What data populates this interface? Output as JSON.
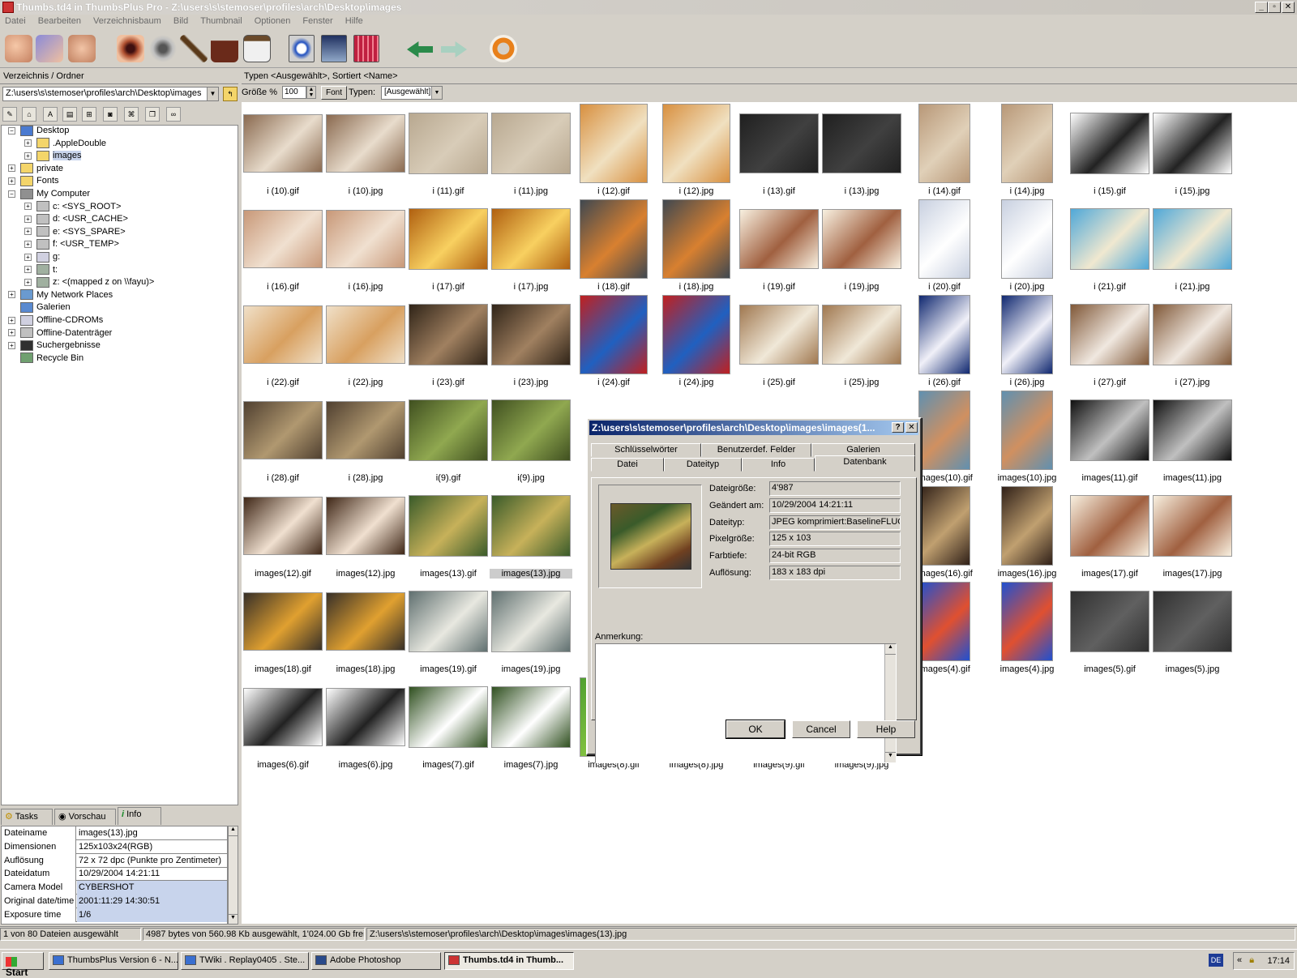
{
  "window": {
    "title": "Thumbs.td4 in ThumbsPlus Pro - Z:\\users\\s\\stemoser\\profiles\\arch\\Desktop\\images",
    "minimize": "_",
    "restore": "▫",
    "close": "✕"
  },
  "menu": [
    "Datei",
    "Bearbeiten",
    "Verzeichnisbaum",
    "Bild",
    "Thumbnail",
    "Optionen",
    "Fenster",
    "Hilfe"
  ],
  "toolbar": {
    "icons": [
      "hand-icon",
      "hand-doc-icon",
      "hand-fingers-icon",
      "eye-icon",
      "glasses-icon",
      "brush-icon",
      "briefcase-icon",
      "clipboard-icon",
      "monitor-icon",
      "slideshow-icon",
      "contact-sheet-icon",
      "back-arrow-icon",
      "forward-arrow-icon",
      "lifebuoy-icon"
    ]
  },
  "left_panel": {
    "header": "Verzeichnis / Ordner",
    "path": "Z:\\users\\s\\stemoser\\profiles\\arch\\Desktop\\images",
    "tree": [
      {
        "label": "Desktop",
        "level": 0,
        "expander": "−",
        "icon": "desktop"
      },
      {
        "label": ".AppleDouble",
        "level": 1,
        "expander": "+",
        "icon": "folder"
      },
      {
        "label": "images",
        "level": 1,
        "expander": "+",
        "icon": "folder-open",
        "selected": true
      },
      {
        "label": "private",
        "level": 0,
        "expander": "+",
        "icon": "folder"
      },
      {
        "label": "Fonts",
        "level": 0,
        "expander": "+",
        "icon": "fonts"
      },
      {
        "label": "My Computer",
        "level": 0,
        "expander": "−",
        "icon": "computer"
      },
      {
        "label": "c: <SYS_ROOT>",
        "level": 1,
        "expander": "+",
        "icon": "drive"
      },
      {
        "label": "d: <USR_CACHE>",
        "level": 1,
        "expander": "+",
        "icon": "drive"
      },
      {
        "label": "e: <SYS_SPARE>",
        "level": 1,
        "expander": "+",
        "icon": "drive"
      },
      {
        "label": "f: <USR_TEMP>",
        "level": 1,
        "expander": "+",
        "icon": "drive"
      },
      {
        "label": "g:",
        "level": 1,
        "expander": "+",
        "icon": "cd"
      },
      {
        "label": "t:",
        "level": 1,
        "expander": "+",
        "icon": "netdrive"
      },
      {
        "label": "z: <(mapped z on \\\\fayu)>",
        "level": 1,
        "expander": "+",
        "icon": "netdrive"
      },
      {
        "label": "My Network Places",
        "level": 0,
        "expander": "+",
        "icon": "network"
      },
      {
        "label": "Galerien",
        "level": 0,
        "expander": "",
        "icon": "gallery"
      },
      {
        "label": "Offline-CDROMs",
        "level": 0,
        "expander": "+",
        "icon": "cd"
      },
      {
        "label": "Offline-Datenträger",
        "level": 0,
        "expander": "+",
        "icon": "drive"
      },
      {
        "label": "Suchergebnisse",
        "level": 0,
        "expander": "+",
        "icon": "binoculars"
      },
      {
        "label": "Recycle Bin",
        "level": 0,
        "expander": "",
        "icon": "recycle"
      }
    ],
    "tabs": [
      "Tasks",
      "Vorschau",
      "Info"
    ],
    "active_tab": "Info",
    "info": [
      {
        "key": "Dateiname",
        "value": "images(13).jpg"
      },
      {
        "key": "Dimensionen",
        "value": "125x103x24(RGB)"
      },
      {
        "key": "Auflösung",
        "value": "72 x 72 dpc (Punkte pro Zentimeter)"
      },
      {
        "key": "Dateidatum",
        "value": "10/29/2004 14:21:11"
      },
      {
        "key": "Camera Model",
        "value": "CYBERSHOT",
        "highlight": true
      },
      {
        "key": "Original date/time",
        "value": "2001:11:29 14:30:51",
        "highlight": true
      },
      {
        "key": "Exposure time",
        "value": "1/6",
        "highlight": true
      }
    ]
  },
  "right_panel": {
    "header": "Typen <Ausgewählt>, Sortiert <Name>",
    "size_label": "Größe %",
    "size_value": "100",
    "font_button": "Font",
    "types_label": "Typen:",
    "types_value": "[Ausgewählt]"
  },
  "thumbnails": [
    {
      "name": "i (10).gif",
      "colors": [
        "#8a6a50",
        "#e8dccc"
      ]
    },
    {
      "name": "i (10).jpg",
      "colors": [
        "#8a6a50",
        "#e8dccc"
      ]
    },
    {
      "name": "i (11).gif",
      "colors": [
        "#b8a890",
        "#d8ccb8"
      ]
    },
    {
      "name": "i (11).jpg",
      "colors": [
        "#b8a890",
        "#d8ccb8"
      ]
    },
    {
      "name": "i (12).gif",
      "colors": [
        "#d89040",
        "#f0e0c0"
      ]
    },
    {
      "name": "i (12).jpg",
      "colors": [
        "#d89040",
        "#f0e0c0"
      ]
    },
    {
      "name": "i (13).gif",
      "colors": [
        "#202020",
        "#404040"
      ]
    },
    {
      "name": "i (13).jpg",
      "colors": [
        "#202020",
        "#404040"
      ]
    },
    {
      "name": "i (14).gif",
      "colors": [
        "#b89878",
        "#e0d0b8"
      ]
    },
    {
      "name": "i (14).jpg",
      "colors": [
        "#b89878",
        "#e0d0b8"
      ]
    },
    {
      "name": "i (15).gif",
      "colors": [
        "#ffffff",
        "#222222"
      ]
    },
    {
      "name": "i (15).jpg",
      "colors": [
        "#ffffff",
        "#222222"
      ]
    },
    {
      "name": "i (16).gif",
      "colors": [
        "#c89878",
        "#f0e0d0"
      ]
    },
    {
      "name": "i (16).jpg",
      "colors": [
        "#c89878",
        "#f0e0d0"
      ]
    },
    {
      "name": "i (17).gif",
      "colors": [
        "#b06010",
        "#f8d060"
      ]
    },
    {
      "name": "i (17).jpg",
      "colors": [
        "#b06010",
        "#f8d060"
      ]
    },
    {
      "name": "i (18).gif",
      "colors": [
        "#404850",
        "#d88030"
      ]
    },
    {
      "name": "i (18).jpg",
      "colors": [
        "#404850",
        "#d88030"
      ]
    },
    {
      "name": "i (19).gif",
      "colors": [
        "#f8f0e0",
        "#a06040"
      ]
    },
    {
      "name": "i (19).jpg",
      "colors": [
        "#f8f0e0",
        "#a06040"
      ]
    },
    {
      "name": "i (20).gif",
      "colors": [
        "#c8d0e0",
        "#ffffff"
      ]
    },
    {
      "name": "i (20).jpg",
      "colors": [
        "#c8d0e0",
        "#ffffff"
      ]
    },
    {
      "name": "i (21).gif",
      "colors": [
        "#50a8d8",
        "#f0e8d0"
      ]
    },
    {
      "name": "i (21).jpg",
      "colors": [
        "#50a8d8",
        "#f0e8d0"
      ]
    },
    {
      "name": "i (22).gif",
      "colors": [
        "#f0e0c8",
        "#d8a060"
      ]
    },
    {
      "name": "i (22).jpg",
      "colors": [
        "#f0e0c8",
        "#d8a060"
      ]
    },
    {
      "name": "i (23).gif",
      "colors": [
        "#302418",
        "#a08060"
      ]
    },
    {
      "name": "i (23).jpg",
      "colors": [
        "#302418",
        "#a08060"
      ]
    },
    {
      "name": "i (24).gif",
      "colors": [
        "#c02020",
        "#2060c0"
      ]
    },
    {
      "name": "i (24).jpg",
      "colors": [
        "#c02020",
        "#2060c0"
      ]
    },
    {
      "name": "i (25).gif",
      "colors": [
        "#a07850",
        "#f0e8d8"
      ]
    },
    {
      "name": "i (25).jpg",
      "colors": [
        "#a07850",
        "#f0e8d8"
      ]
    },
    {
      "name": "i (26).gif",
      "colors": [
        "#102870",
        "#f0f0f8"
      ]
    },
    {
      "name": "i (26).jpg",
      "colors": [
        "#102870",
        "#f0f0f8"
      ]
    },
    {
      "name": "i (27).gif",
      "colors": [
        "#805838",
        "#f0e8e0"
      ]
    },
    {
      "name": "i (27).jpg",
      "colors": [
        "#805838",
        "#f0e8e0"
      ]
    },
    {
      "name": "i (28).gif",
      "colors": [
        "#504030",
        "#b09870"
      ]
    },
    {
      "name": "i (28).jpg",
      "colors": [
        "#504030",
        "#b09870"
      ]
    },
    {
      "name": "i(9).gif",
      "colors": [
        "#405020",
        "#90a850"
      ]
    },
    {
      "name": "i(9).jpg",
      "colors": [
        "#405020",
        "#90a850"
      ]
    },
    {
      "name": "",
      "colors": [
        "#ffffff",
        "#ffffff"
      ]
    },
    {
      "name": "",
      "colors": [
        "#ffffff",
        "#ffffff"
      ]
    },
    {
      "name": "",
      "colors": [
        "#ffffff",
        "#ffffff"
      ]
    },
    {
      "name": "",
      "colors": [
        "#ffffff",
        "#ffffff"
      ]
    },
    {
      "name": "images(10).gif",
      "colors": [
        "#6090b0",
        "#d09060"
      ]
    },
    {
      "name": "images(10).jpg",
      "colors": [
        "#6090b0",
        "#d09060"
      ]
    },
    {
      "name": "images(11).gif",
      "colors": [
        "#101010",
        "#c0c0c0"
      ]
    },
    {
      "name": "images(11).jpg",
      "colors": [
        "#101010",
        "#c0c0c0"
      ]
    },
    {
      "name": "images(12).gif",
      "colors": [
        "#402818",
        "#f0e0d0"
      ]
    },
    {
      "name": "images(12).jpg",
      "colors": [
        "#402818",
        "#f0e0d0"
      ]
    },
    {
      "name": "images(13).gif",
      "colors": [
        "#3a5b2a",
        "#c7b15a"
      ]
    },
    {
      "name": "images(13).jpg",
      "colors": [
        "#3a5b2a",
        "#c7b15a"
      ],
      "selected": true
    },
    {
      "name": "",
      "colors": [
        "#ffffff",
        "#ffffff"
      ]
    },
    {
      "name": "",
      "colors": [
        "#ffffff",
        "#ffffff"
      ]
    },
    {
      "name": "",
      "colors": [
        "#ffffff",
        "#ffffff"
      ]
    },
    {
      "name": "",
      "colors": [
        "#ffffff",
        "#ffffff"
      ]
    },
    {
      "name": "images(16).gif",
      "colors": [
        "#302018",
        "#c0a070"
      ]
    },
    {
      "name": "images(16).jpg",
      "colors": [
        "#302018",
        "#c0a070"
      ]
    },
    {
      "name": "images(17).gif",
      "colors": [
        "#f8f0e0",
        "#a06040"
      ]
    },
    {
      "name": "images(17).jpg",
      "colors": [
        "#f8f0e0",
        "#a06040"
      ]
    },
    {
      "name": "images(18).gif",
      "colors": [
        "#383028",
        "#e0a030"
      ]
    },
    {
      "name": "images(18).jpg",
      "colors": [
        "#383028",
        "#e0a030"
      ]
    },
    {
      "name": "images(19).gif",
      "colors": [
        "#607070",
        "#e8e8e0"
      ]
    },
    {
      "name": "images(19).jpg",
      "colors": [
        "#607070",
        "#e8e8e0"
      ]
    },
    {
      "name": "",
      "colors": [
        "#ffffff",
        "#ffffff"
      ]
    },
    {
      "name": "",
      "colors": [
        "#ffffff",
        "#ffffff"
      ]
    },
    {
      "name": "",
      "colors": [
        "#ffffff",
        "#ffffff"
      ]
    },
    {
      "name": "",
      "colors": [
        "#ffffff",
        "#ffffff"
      ]
    },
    {
      "name": "images(4).gif",
      "colors": [
        "#2050d0",
        "#e05030"
      ]
    },
    {
      "name": "images(4).jpg",
      "colors": [
        "#2050d0",
        "#e05030"
      ]
    },
    {
      "name": "images(5).gif",
      "colors": [
        "#303030",
        "#606060"
      ]
    },
    {
      "name": "images(5).jpg",
      "colors": [
        "#303030",
        "#606060"
      ]
    },
    {
      "name": "images(6).gif",
      "colors": [
        "#ffffff",
        "#222222"
      ]
    },
    {
      "name": "images(6).jpg",
      "colors": [
        "#ffffff",
        "#222222"
      ]
    },
    {
      "name": "images(7).gif",
      "colors": [
        "#305020",
        "#ffffff"
      ]
    },
    {
      "name": "images(7).jpg",
      "colors": [
        "#305020",
        "#ffffff"
      ]
    },
    {
      "name": "images(8).gif",
      "colors": [
        "#50a030",
        "#80c040"
      ]
    },
    {
      "name": "images(8).jpg",
      "colors": [
        "#50a030",
        "#80c040"
      ]
    },
    {
      "name": "images(9).gif",
      "colors": [
        "#ffffff",
        "#ffffff"
      ]
    },
    {
      "name": "images(9).jpg",
      "colors": [
        "#ffffff",
        "#ffffff"
      ]
    }
  ],
  "dialog": {
    "title": "Z:\\users\\s\\stemoser\\profiles\\arch\\Desktop\\images\\images(1...",
    "help_btn": "?",
    "close_btn": "✕",
    "tabs_row1": [
      "Schlüsselwörter",
      "Benutzerdef. Felder",
      "Galerien"
    ],
    "tabs_row2": [
      "Datei",
      "Dateityp",
      "Info",
      "Datenbank"
    ],
    "active_tab": "Datenbank",
    "fields": [
      {
        "key": "Dateigröße:",
        "value": "4'987"
      },
      {
        "key": "Geändert am:",
        "value": "10/29/2004 14:21:11"
      },
      {
        "key": "Dateityp:",
        "value": "JPEG komprimiert:BaselineFLUOV"
      },
      {
        "key": "Pixelgröße:",
        "value": "125 x 103"
      },
      {
        "key": "Farbtiefe:",
        "value": "24-bit RGB"
      },
      {
        "key": "Auflösung:",
        "value": "183 x 183 dpi"
      }
    ],
    "note_label": "Anmerkung:",
    "note_value": "",
    "buttons": {
      "ok": "OK",
      "cancel": "Cancel",
      "help": "Help"
    }
  },
  "statusbar": {
    "selection": "1 von 80 Dateien ausgewählt",
    "bytes": "4987 bytes von 560.98 Kb ausgewählt, 1'024.00 Gb frei",
    "path": "Z:\\users\\s\\stemoser\\profiles\\arch\\Desktop\\images\\images(13).jpg"
  },
  "taskbar": {
    "start": "Start",
    "tasks": [
      {
        "label": "ThumbsPlus Version 6 - N...",
        "icon_color": "#3a6fd0"
      },
      {
        "label": "TWiki . Replay0405 . Ste...",
        "icon_color": "#3a6fd0"
      },
      {
        "label": "Adobe Photoshop",
        "icon_color": "#2a4a8a"
      },
      {
        "label": "Thumbs.td4 in Thumb...",
        "icon_color": "#c33",
        "active": true
      }
    ],
    "lang": "DE",
    "chevron": "«",
    "clock": "17:14"
  }
}
